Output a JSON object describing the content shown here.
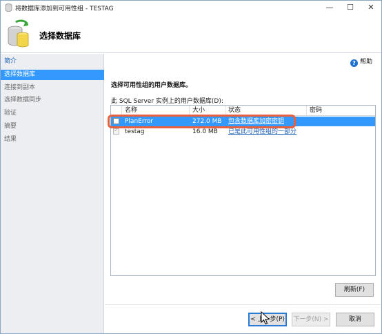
{
  "window": {
    "title": "将数据库添加到可用性组 - TESTAG",
    "minimize_glyph": "—",
    "maximize_glyph": "☐",
    "close_glyph": "✕"
  },
  "header": {
    "title": "选择数据库",
    "icon": "database-add-icon"
  },
  "nav": {
    "items": [
      {
        "label": "简介",
        "state": "link"
      },
      {
        "label": "选择数据库",
        "state": "selected"
      },
      {
        "label": "连接到副本",
        "state": "disabled"
      },
      {
        "label": "选择数据同步",
        "state": "disabled"
      },
      {
        "label": "验证",
        "state": "disabled"
      },
      {
        "label": "摘要",
        "state": "disabled"
      },
      {
        "label": "结果",
        "state": "disabled"
      }
    ]
  },
  "help": {
    "label": "帮助",
    "icon_glyph": "?"
  },
  "main": {
    "instruction": "选择可用性组的用户数据库。",
    "grid_label": "此 SQL Server 实例上的用户数据库(D):",
    "grid": {
      "columns": [
        "名称",
        "大小",
        "状态",
        "密码"
      ],
      "rows": [
        {
          "checked": false,
          "name": "PlanError",
          "size": "272.0 MB",
          "status": "包含数据库加密密钥",
          "password": "",
          "selected": true
        },
        {
          "checked": true,
          "name": "testag",
          "size": "16.0 MB",
          "status": "已是此可用性组的一部分",
          "password": "",
          "selected": false
        }
      ]
    }
  },
  "buttons": {
    "refresh": "刷新(F)",
    "prev": "< 上一步(P)",
    "next": "下一步(N) >",
    "cancel": "取消"
  },
  "colors": {
    "selection": "#3399ff",
    "link": "#1a5fb4",
    "annotation": "#e8613e"
  }
}
